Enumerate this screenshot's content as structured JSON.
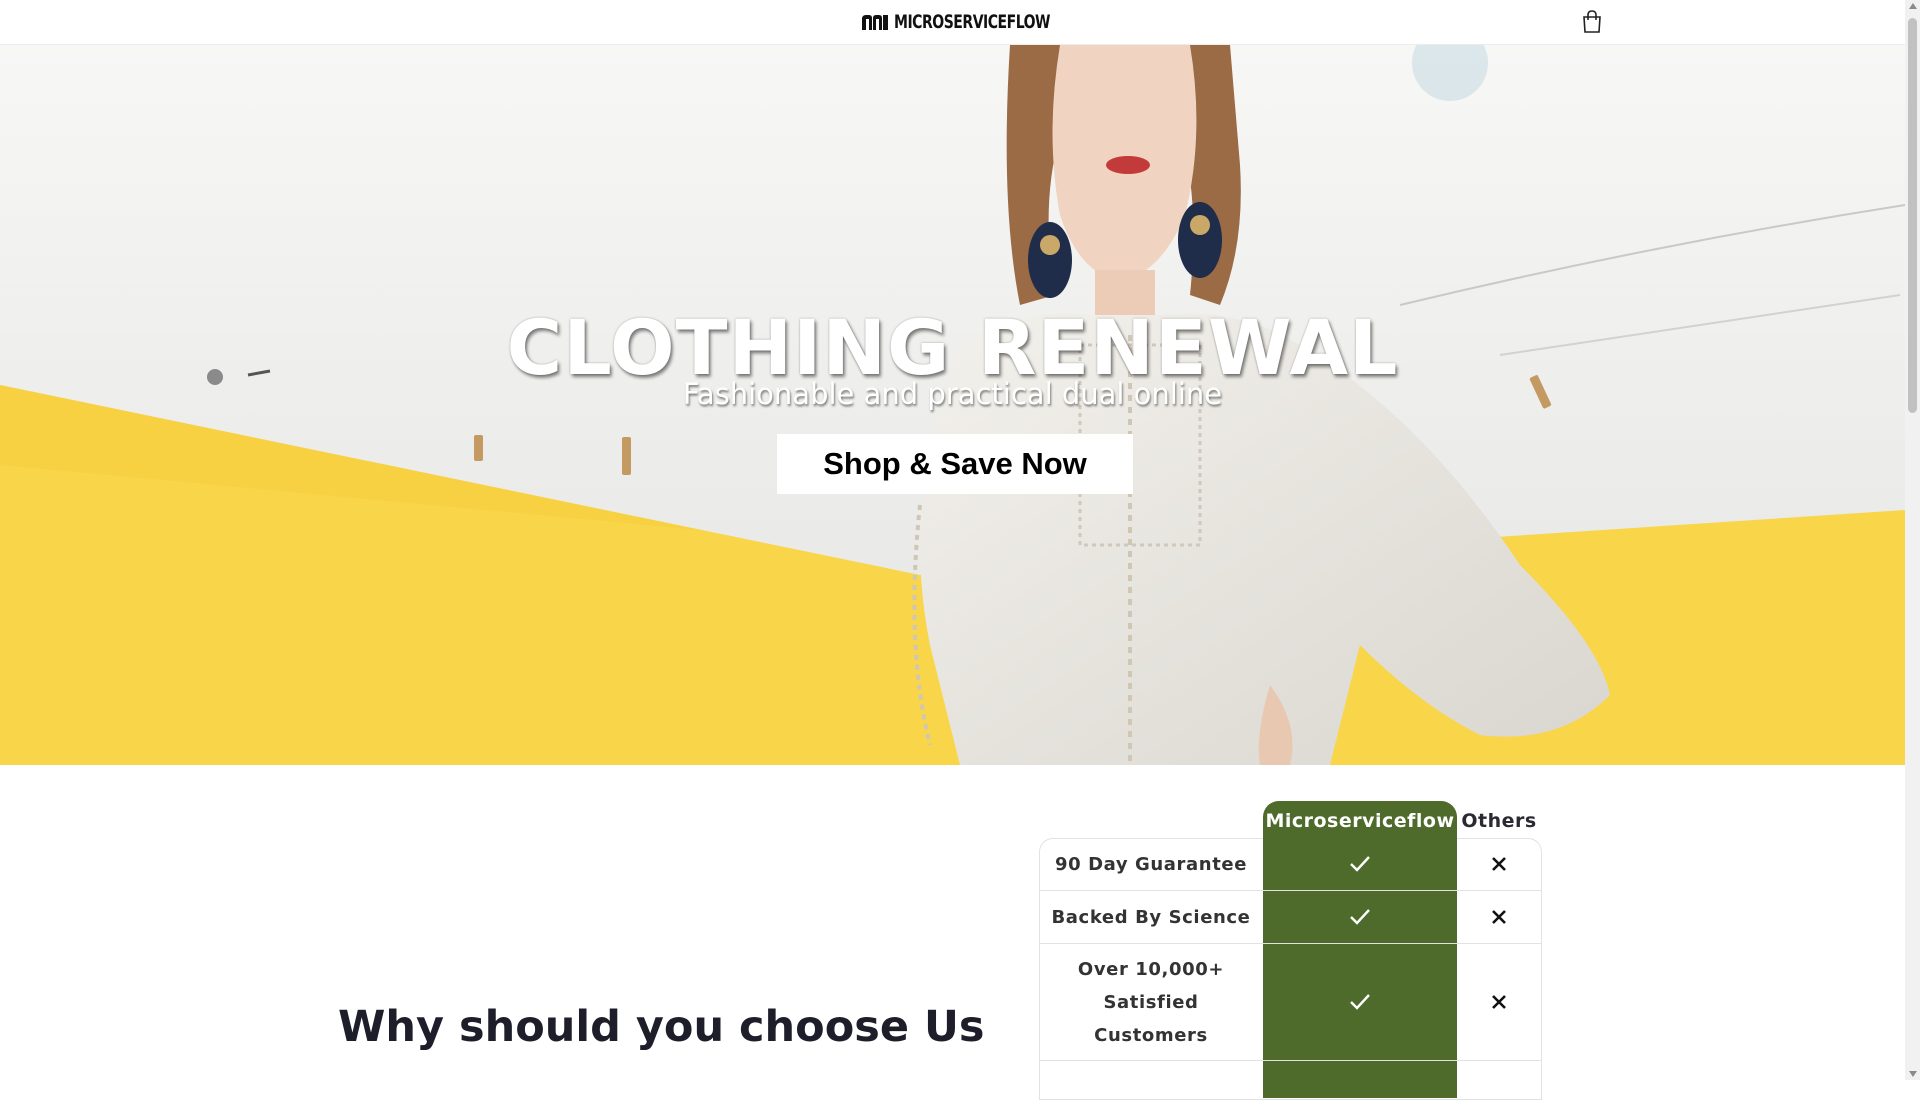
{
  "header": {
    "logo_text": "MICROSERVICEFLOW",
    "logo_icon": "microserviceflow-logo-icon",
    "cart_icon": "shopping-bag-icon"
  },
  "hero": {
    "title": "CLOTHING RENEWAL",
    "subtitle": "Fashionable and practical dual online",
    "cta_label": "Shop & Save Now"
  },
  "why": {
    "heading": "Why should you choose Us"
  },
  "comparison": {
    "brand_heading": "Microserviceflow",
    "others_heading": "Others",
    "rows": [
      {
        "label": "90 Day Guarantee",
        "brand": "check-icon",
        "others": "close-icon"
      },
      {
        "label": "Backed By Science",
        "brand": "check-icon",
        "others": "close-icon"
      },
      {
        "label": "Over 10,000+ Satisfied Customers",
        "brand": "check-icon",
        "others": "close-icon"
      }
    ]
  },
  "colors": {
    "brand_green": "#4e6b2b",
    "hero_yellow": "#f9d54a",
    "text_dark": "#1e1e2a"
  }
}
